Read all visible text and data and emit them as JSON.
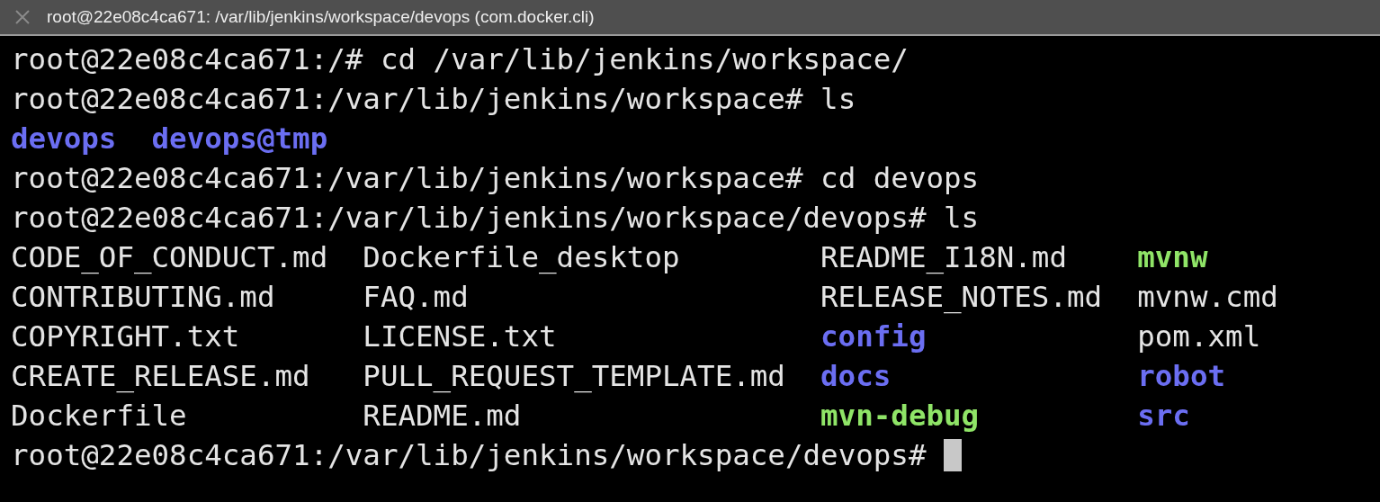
{
  "window": {
    "title": "root@22e08c4ca671: /var/lib/jenkins/workspace/devops (com.docker.cli)"
  },
  "lines": [
    {
      "kind": "prompt",
      "text": "root@22e08c4ca671:/# cd /var/lib/jenkins/workspace/"
    },
    {
      "kind": "prompt",
      "text": "root@22e08c4ca671:/var/lib/jenkins/workspace# ls"
    },
    {
      "kind": "listing",
      "rows": [
        [
          {
            "name": "devops",
            "kind": "dir"
          },
          {
            "name": "devops@tmp",
            "kind": "dir"
          }
        ]
      ]
    },
    {
      "kind": "prompt",
      "text": "root@22e08c4ca671:/var/lib/jenkins/workspace# cd devops"
    },
    {
      "kind": "prompt",
      "text": "root@22e08c4ca671:/var/lib/jenkins/workspace/devops# ls"
    },
    {
      "kind": "listing",
      "rows": [
        [
          {
            "name": "CODE_OF_CONDUCT.md",
            "kind": "file"
          },
          {
            "name": "Dockerfile_desktop",
            "kind": "file"
          },
          {
            "name": "README_I18N.md",
            "kind": "file"
          },
          {
            "name": "mvnw",
            "kind": "exec"
          }
        ],
        [
          {
            "name": "CONTRIBUTING.md",
            "kind": "file"
          },
          {
            "name": "FAQ.md",
            "kind": "file"
          },
          {
            "name": "RELEASE_NOTES.md",
            "kind": "file"
          },
          {
            "name": "mvnw.cmd",
            "kind": "file"
          }
        ],
        [
          {
            "name": "COPYRIGHT.txt",
            "kind": "file"
          },
          {
            "name": "LICENSE.txt",
            "kind": "file"
          },
          {
            "name": "config",
            "kind": "dir"
          },
          {
            "name": "pom.xml",
            "kind": "file"
          }
        ],
        [
          {
            "name": "CREATE_RELEASE.md",
            "kind": "file"
          },
          {
            "name": "PULL_REQUEST_TEMPLATE.md",
            "kind": "file"
          },
          {
            "name": "docs",
            "kind": "dir"
          },
          {
            "name": "robot",
            "kind": "dir"
          }
        ],
        [
          {
            "name": "Dockerfile",
            "kind": "file"
          },
          {
            "name": "README.md",
            "kind": "file"
          },
          {
            "name": "mvn-debug",
            "kind": "exec"
          },
          {
            "name": "src",
            "kind": "dir"
          }
        ]
      ]
    },
    {
      "kind": "prompt",
      "text": "root@22e08c4ca671:/var/lib/jenkins/workspace/devops#",
      "cursor": true
    }
  ]
}
